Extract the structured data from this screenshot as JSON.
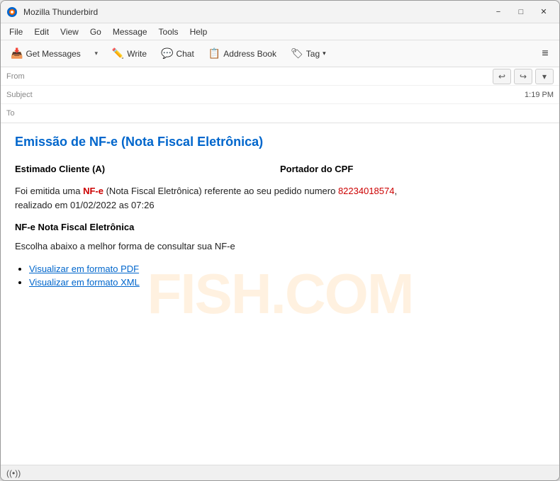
{
  "window": {
    "title": "Mozilla Thunderbird",
    "icon": "thunderbird"
  },
  "titlebar": {
    "title": "Mozilla Thunderbird",
    "minimize_label": "−",
    "maximize_label": "□",
    "close_label": "✕"
  },
  "menubar": {
    "items": [
      {
        "label": "File"
      },
      {
        "label": "Edit"
      },
      {
        "label": "View"
      },
      {
        "label": "Go"
      },
      {
        "label": "Message"
      },
      {
        "label": "Tools"
      },
      {
        "label": "Help"
      }
    ]
  },
  "toolbar": {
    "get_messages_label": "Get Messages",
    "write_label": "Write",
    "chat_label": "Chat",
    "address_book_label": "Address Book",
    "tag_label": "Tag",
    "menu_btn_label": "≡"
  },
  "header": {
    "from_label": "From",
    "from_value": "",
    "subject_label": "Subject",
    "subject_value": "",
    "to_label": "To",
    "to_value": "",
    "time": "1:19 PM",
    "reply_icon": "↩",
    "forward_icon": "↪",
    "more_icon": "▾"
  },
  "email": {
    "subject": "Emissão de NF-e (Nota Fiscal Eletrônica)",
    "greeting_left": "Estimado Cliente (A)",
    "greeting_right": "Portador do CPF",
    "body_text_1": "Foi emitida uma ",
    "body_nfe_highlight": "NF-e",
    "body_text_2": " (Nota Fiscal Eletrônica) referente ao seu pedido numero ",
    "body_number_highlight": "82234018574",
    "body_text_3": ",",
    "body_text_4": "realizado em 01/02/2022 as 07:26",
    "section_title": "NF-e Nota Fiscal Eletrônica",
    "section_text": "Escolha abaixo a melhor forma de consultar sua NF-e",
    "links": [
      {
        "label": "Visualizar em formato PDF"
      },
      {
        "label": "Visualizar em formato XML"
      }
    ]
  },
  "watermark": {
    "text": "FISH.COM"
  },
  "statusbar": {
    "icon": "((•))"
  }
}
